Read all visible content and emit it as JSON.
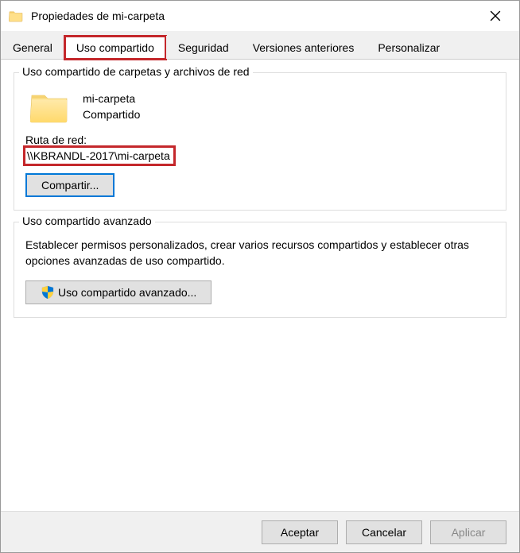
{
  "window": {
    "title": "Propiedades de mi-carpeta"
  },
  "tabs": {
    "general": "General",
    "sharing": "Uso compartido",
    "security": "Seguridad",
    "previous": "Versiones anteriores",
    "customize": "Personalizar"
  },
  "share_group": {
    "title": "Uso compartido de carpetas y archivos de red",
    "folder_name": "mi-carpeta",
    "status": "Compartido",
    "net_path_label": "Ruta de red:",
    "net_path": "\\\\KBRANDL-2017\\mi-carpeta",
    "share_button": "Compartir..."
  },
  "adv_group": {
    "title": "Uso compartido avanzado",
    "description": "Establecer permisos personalizados, crear varios recursos compartidos y establecer otras opciones avanzadas de uso compartido.",
    "button": "Uso compartido avanzado..."
  },
  "footer": {
    "ok": "Aceptar",
    "cancel": "Cancelar",
    "apply": "Aplicar"
  }
}
